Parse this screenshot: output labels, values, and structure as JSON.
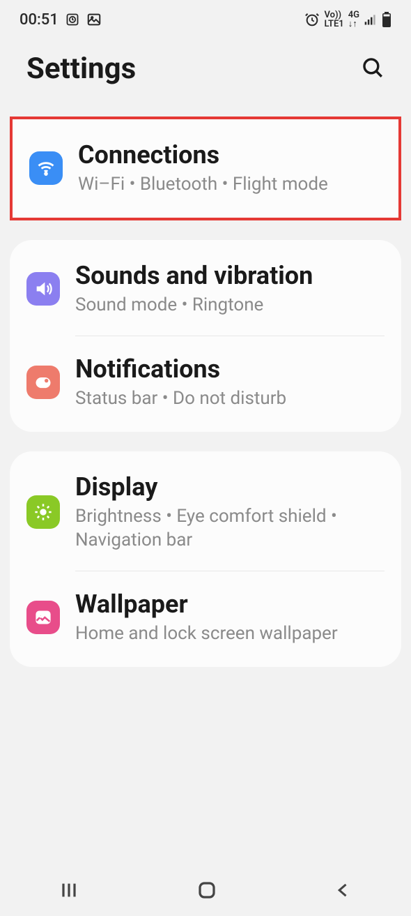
{
  "status": {
    "time": "00:51",
    "volte": "Vo))",
    "lte": "LTE1",
    "network": "4G"
  },
  "header": {
    "title": "Settings"
  },
  "groups": [
    {
      "items": [
        {
          "title": "Connections",
          "subtitle": "Wi–Fi  •  Bluetooth  •  Flight mode"
        }
      ]
    },
    {
      "items": [
        {
          "title": "Sounds and vibration",
          "subtitle": "Sound mode  •  Ringtone"
        },
        {
          "title": "Notifications",
          "subtitle": "Status bar  •  Do not disturb"
        }
      ]
    },
    {
      "items": [
        {
          "title": "Display",
          "subtitle": "Brightness  •  Eye comfort shield  •  Navigation bar"
        },
        {
          "title": "Wallpaper",
          "subtitle": "Home and lock screen wallpaper"
        }
      ]
    }
  ]
}
